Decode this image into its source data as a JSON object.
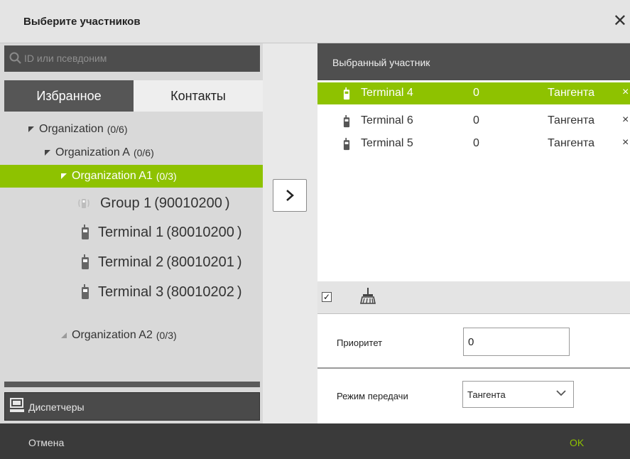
{
  "dialog": {
    "title": "Выберите участников",
    "close_icon": "close-icon"
  },
  "search": {
    "placeholder": "ID или псевдоним",
    "icon": "search-icon"
  },
  "tabs": [
    {
      "label": "Избранное",
      "active": true
    },
    {
      "label": "Контакты",
      "active": false
    }
  ],
  "tree": [
    {
      "label": "Organization",
      "count": "(0/6)",
      "expanded": true
    },
    {
      "label": "Organization A",
      "count": "(0/6)",
      "expanded": true
    },
    {
      "label": "Organization A1",
      "count": "(0/3)",
      "expanded": true,
      "selected": true
    },
    {
      "label": "Group 1 (90010200 )",
      "icon": "group-icon"
    },
    {
      "label": "Terminal 1 (80010200 )",
      "icon": "radio-terminal-icon"
    },
    {
      "label": "Terminal 2 (80010201 )",
      "icon": "radio-terminal-icon"
    },
    {
      "label": "Terminal 3 (80010202 )",
      "icon": "radio-terminal-icon"
    },
    {
      "label": "Organization A2",
      "count": "(0/3)",
      "expanded": false
    }
  ],
  "dispatchers": {
    "label": "Диспетчеры",
    "icon": "dispatcher-console-icon"
  },
  "selected": {
    "header": "Выбранный участник",
    "rows": [
      {
        "name": "Terminal 4",
        "num": "0",
        "mode": "Тангента",
        "active": true
      },
      {
        "name": "Terminal 6",
        "num": "0",
        "mode": "Тангента",
        "active": false
      },
      {
        "name": "Terminal 5",
        "num": "0",
        "mode": "Тангента",
        "active": false
      }
    ],
    "remove_glyph": "×"
  },
  "toolbar": {
    "checkbox_checked": true,
    "checkbox_glyph": "✓",
    "clear_icon": "broom-icon"
  },
  "properties": {
    "priority_label": "Приоритет",
    "priority_value": "0",
    "mode_label": "Режим передачи",
    "mode_value": "Тангента"
  },
  "footer": {
    "cancel": "Отмена",
    "ok": "OK"
  },
  "colors": {
    "accent": "#8ec200",
    "dark": "#3a3a3a"
  }
}
